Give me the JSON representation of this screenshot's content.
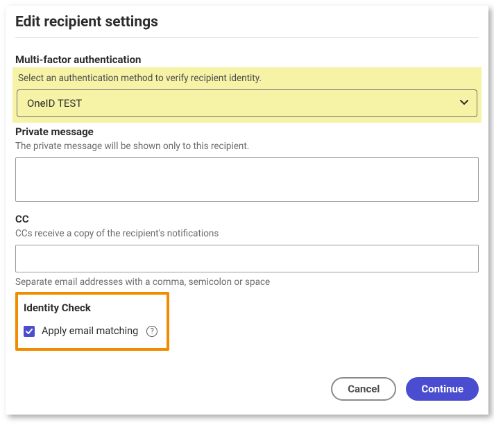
{
  "title": "Edit recipient settings",
  "mfa": {
    "label": "Multi-factor authentication",
    "hint": "Select an authentication method to verify recipient identity.",
    "selected": "OneID TEST"
  },
  "privateMessage": {
    "label": "Private message",
    "hint": "The private message will be shown only to this recipient.",
    "value": ""
  },
  "cc": {
    "label": "CC",
    "hint": "CCs receive a copy of the recipient's notifications",
    "value": "",
    "postHint": "Separate email addresses with a comma, semicolon or space"
  },
  "identity": {
    "label": "Identity Check",
    "checkboxLabel": "Apply email matching",
    "checked": true
  },
  "footer": {
    "cancel": "Cancel",
    "continue": "Continue"
  },
  "helpGlyph": "?"
}
